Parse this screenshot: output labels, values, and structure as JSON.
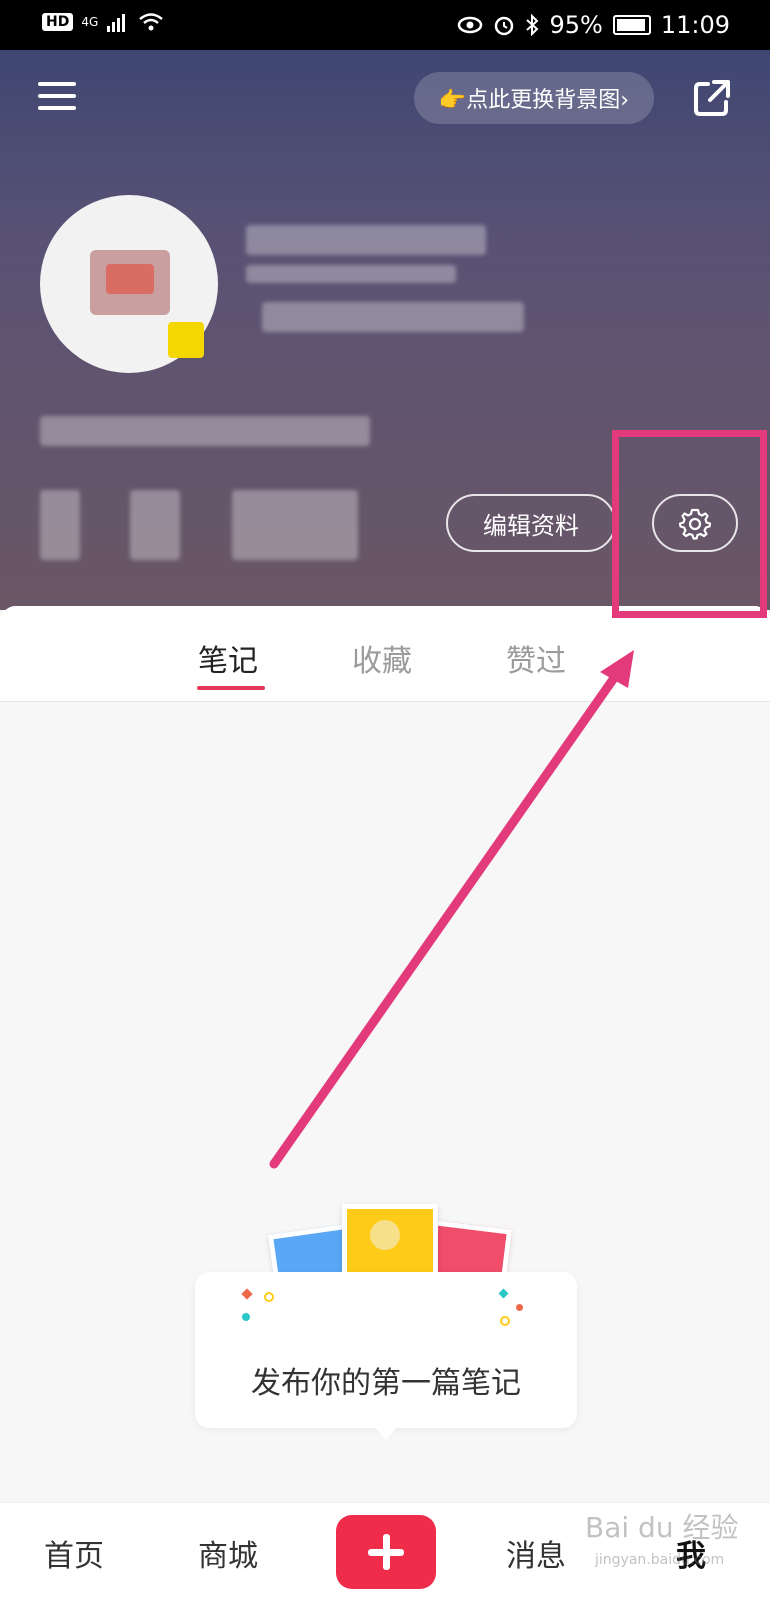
{
  "status_bar": {
    "hd": "HD",
    "network": "4G",
    "battery": "95%",
    "battery_level": 0.95,
    "time": "11:09"
  },
  "header": {
    "change_bg_label": "👉点此更换背景图›",
    "edit_profile_label": "编辑资料"
  },
  "tabs": [
    {
      "label": "笔记",
      "active": true
    },
    {
      "label": "收藏",
      "active": false
    },
    {
      "label": "赞过",
      "active": false
    }
  ],
  "empty_state": {
    "text": "发布你的第一篇笔记"
  },
  "bottom_nav": {
    "home": "首页",
    "mall": "商城",
    "messages": "消息",
    "me": "我"
  },
  "watermark": {
    "text": "Bai du 经验",
    "sub": "jingyan.baidu.com"
  },
  "colors": {
    "accent": "#e2365a",
    "highlight": "#e23a7a",
    "add_button": "#ef2d4a"
  },
  "icons": [
    "menu-icon",
    "share-icon",
    "settings-gear-icon",
    "plus-icon",
    "wifi-icon",
    "signal-icon",
    "alarm-icon",
    "eye-icon",
    "bluetooth-icon",
    "battery-icon"
  ]
}
